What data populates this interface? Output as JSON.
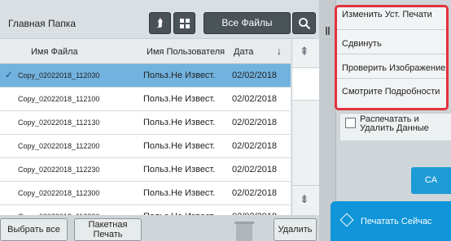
{
  "toolbar": {
    "folder_title": "Главная Папка",
    "up_icon": "arrow-up-return-icon",
    "grid_icon": "grid-view-icon",
    "all_files_label": "Все Файлы",
    "search_icon": "search-icon"
  },
  "table": {
    "columns": [
      "Имя Файла",
      "Имя Пользователя",
      "Дата"
    ],
    "sort_arrow": "↓",
    "rows": [
      {
        "check": "✓",
        "file": "Copy_02022018_112030",
        "user": "Польз.Не Извест.",
        "date": "02/02/2018"
      },
      {
        "check": "",
        "file": "Copy_02022018_112100",
        "user": "Польз.Не Извест.",
        "date": "02/02/2018"
      },
      {
        "check": "",
        "file": "Copy_02022018_112130",
        "user": "Польз.Не Извест.",
        "date": "02/02/2018"
      },
      {
        "check": "",
        "file": "Copy_02022018_112200",
        "user": "Польз.Не Извест.",
        "date": "02/02/2018"
      },
      {
        "check": "",
        "file": "Copy_02022018_112230",
        "user": "Польз.Не Извест.",
        "date": "02/02/2018"
      },
      {
        "check": "",
        "file": "Copy_02022018_112300",
        "user": "Польз.Не Извест.",
        "date": "02/02/2018"
      },
      {
        "check": "",
        "file": "Copy_02022018_112330",
        "user": "Польз.Не Извест.",
        "date": "02/02/2018"
      }
    ]
  },
  "scroll": {
    "up": "⇞",
    "down": "⇟"
  },
  "bottom": {
    "select_all": "Выбрать все",
    "batch_print": "Пакетная Печать",
    "delete": "Удалить"
  },
  "menu": {
    "items": [
      "Изменить Уст. Печати",
      "Сдвинуть",
      "Проверить Изображение",
      "Смотрите Подробности"
    ]
  },
  "print_and_delete": "Распечатать и Удалить Данные",
  "ca_label": "CA",
  "start_print": "Печатать Сейчас",
  "colors": {
    "selection": "#72b2df",
    "accent": "#0f95d8",
    "highlight_border": "#e2323b"
  }
}
